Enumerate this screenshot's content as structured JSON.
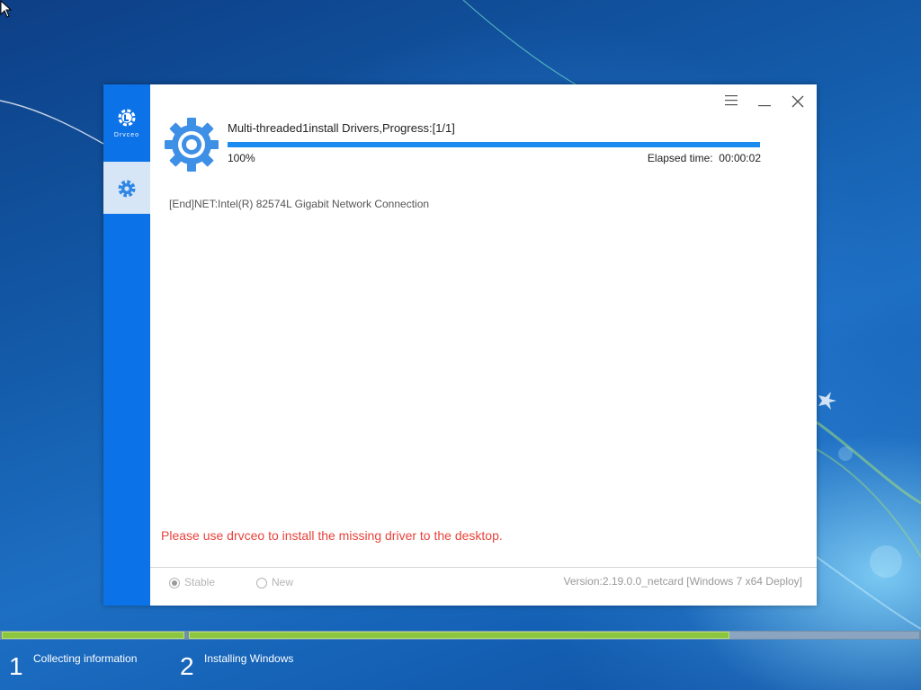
{
  "app": {
    "logo_text": "Drvceo",
    "status_title": "Multi-threaded1install Drivers,Progress:[1/1]",
    "progress_percent": "100%",
    "progress_value": 1.0,
    "elapsed_label": "Elapsed time:",
    "elapsed_value": "00:00:02",
    "log_lines": [
      "[End]NET:Intel(R) 82574L Gigabit Network Connection"
    ],
    "warning": "Please use drvceo to install the missing driver to the desktop.",
    "options": {
      "stable_label": "Stable",
      "new_label": "New",
      "selected": "stable"
    },
    "version": "Version:2.19.0.0_netcard [Windows 7 x64 Deploy]",
    "accent_color": "#0b72e8",
    "progress_color": "#1c8bf0",
    "warning_color": "#e8433b",
    "icons": {
      "logo": "drvceo-logo-icon",
      "sidebar_tab": "gear-icon",
      "main": "gear-icon",
      "menu": "menu-icon",
      "minimize": "minimize-icon",
      "close": "close-icon"
    }
  },
  "setup": {
    "steps": [
      {
        "number": "1",
        "label": "Collecting information",
        "progress": 1.0
      },
      {
        "number": "2",
        "label": "Installing Windows",
        "progress": 0.74
      }
    ]
  }
}
